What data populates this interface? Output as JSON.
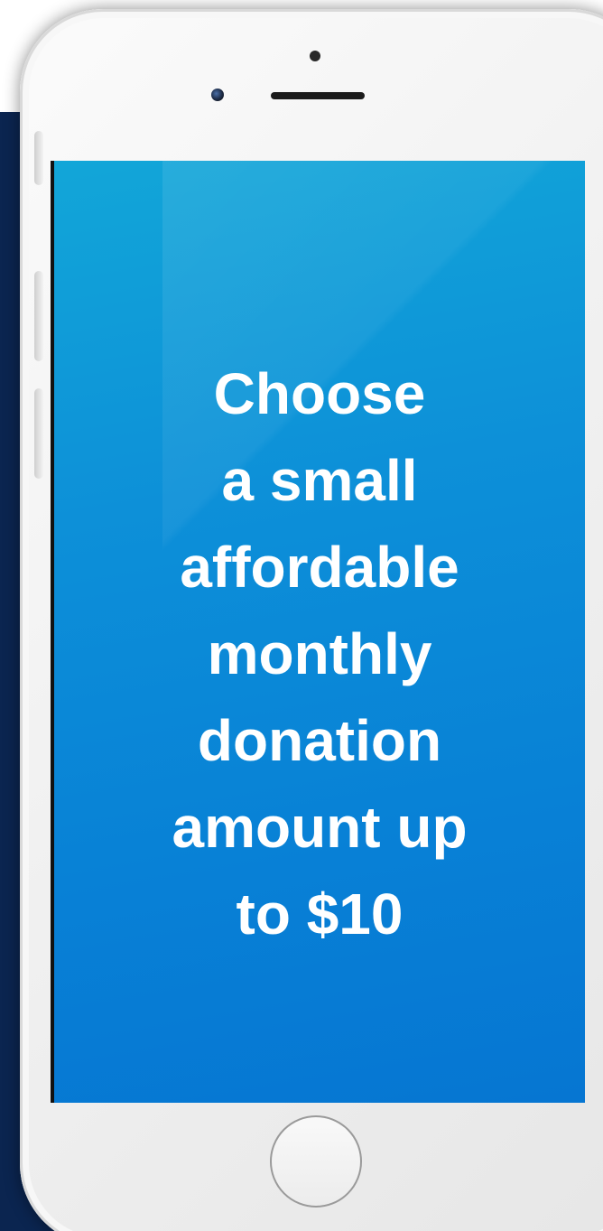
{
  "screen": {
    "message_lines": [
      "Choose",
      "a small",
      "affordable",
      "monthly",
      "donation",
      "amount up",
      "to $10"
    ],
    "gradient_colors": [
      "#12a6d8",
      "#0676d2"
    ],
    "text_color": "#ffffff"
  },
  "backdrop": {
    "color": "#0b2550"
  },
  "device": {
    "frame_color": "#f1f1f1",
    "icons": [
      "speaker-icon",
      "sensor-icon",
      "front-camera-icon",
      "home-button-icon"
    ]
  }
}
